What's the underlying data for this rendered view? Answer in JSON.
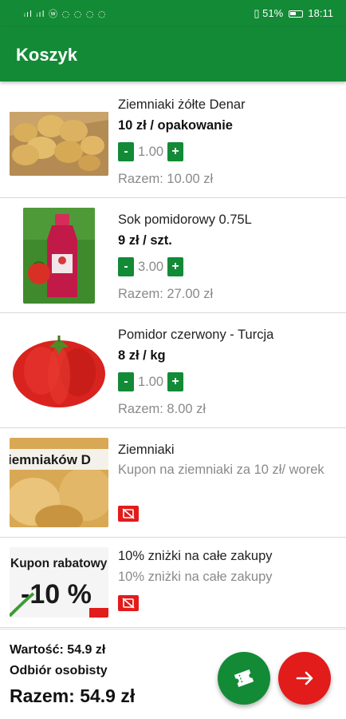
{
  "status_bar": {
    "left_icons": "ᵢıl ᵢıl ⓦ ◌ ◌ ◌ ◌",
    "battery": "51%",
    "time": "18:11"
  },
  "app_bar": {
    "title": "Koszyk"
  },
  "colors": {
    "primary": "#138a36",
    "danger": "#e21b1b",
    "muted": "#8a8a8a"
  },
  "cart": {
    "items": [
      {
        "name": "Ziemniaki żółte Denar",
        "price": "10 zł / opakowanie",
        "minus": "-",
        "qty": "1.00",
        "plus": "+",
        "total": "Razem: 10.00 zł"
      },
      {
        "name": "Sok pomidorowy 0.75L",
        "price": "9 zł / szt.",
        "minus": "-",
        "qty": "3.00",
        "plus": "+",
        "total": "Razem: 27.00 zł"
      },
      {
        "name": "Pomidor czerwony - Turcja",
        "price": "8 zł / kg",
        "minus": "-",
        "qty": "1.00",
        "plus": "+",
        "total": "Razem: 8.00 zł"
      }
    ],
    "coupons": [
      {
        "name": "Ziemniaki",
        "description": "Kupon na ziemniaki za 10 zł/ worek",
        "image_text": "iemniaków D"
      },
      {
        "name": "10% zniżki na całe zakupy",
        "description": "10% zniżki na całe zakupy",
        "image_text_top": "Kupon rabatowy",
        "image_text_big": "-10 %"
      }
    ]
  },
  "footer": {
    "value": "Wartość: 54.9 zł",
    "pickup": "Odbiór osobisty",
    "total": "Razem: 54.9 zł"
  }
}
